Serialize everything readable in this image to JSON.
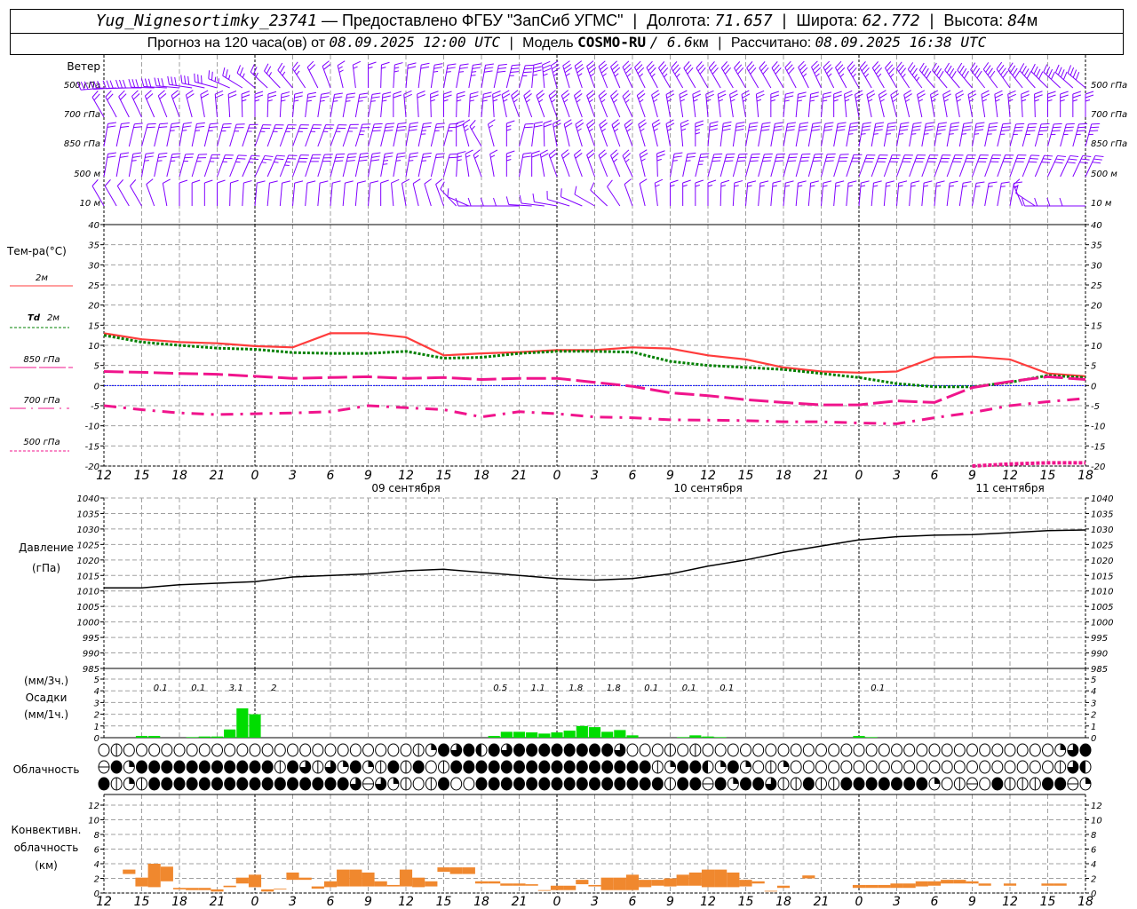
{
  "header": {
    "station": "Yug_Nignesortimky_23741",
    "dash": "—",
    "provider": "Предоставлено ФГБУ \"ЗапСиб УГМС\"",
    "lon_label": "Долгота:",
    "lon_value": "71.657",
    "lat_label": "Широта:",
    "lat_value": "62.772",
    "alt_label": "Высота:",
    "alt_value": "84",
    "alt_unit": "м",
    "forecast_label": "Прогноз на 120 часа(ов) от",
    "forecast_start": "08.09.2025 12:00 UTC",
    "model_label": "Модель",
    "model_name": "COSMO-RU",
    "model_res": "/ 6.6",
    "model_res_unit": "км",
    "calc_label": "Рассчитано:",
    "calc_time": "08.09.2025 16:38 UTC",
    "sep": "|"
  },
  "labels": {
    "wind_title": "Ветер",
    "wind_levels": [
      "500 гПа",
      "700 гПа",
      "850 гПа",
      "500 м",
      "10 м"
    ],
    "temp_title": "Тем-ра(°С)",
    "t2m": "2м",
    "td2m_a": "Td",
    "td2m_b": "2м",
    "t850": "850 гПа",
    "t700": "700 гПа",
    "t500": "500 гПа",
    "pressure_a": "Давление",
    "pressure_b": "(гПа)",
    "precip_a": "(мм/3ч.)",
    "precip_b": "Осадки",
    "precip_c": "(мм/1ч.)",
    "cloud": "Облачность",
    "conv_a": "Конвективн.",
    "conv_b": "облачность",
    "conv_c": "(км)",
    "dates": [
      "09 сентября",
      "10 сентября",
      "11 сентября"
    ]
  },
  "colors": {
    "wind": "#8000ff",
    "t2m": "#ff3c3c",
    "td2m": "#008000",
    "t850": "#f0148c",
    "t700": "#f0148c",
    "t500": "#f0148c",
    "zero_line": "#0000ff",
    "precip": "#00dd00",
    "convective": "#f0882e",
    "grid": "#a0a0a0"
  },
  "chart_data": {
    "type": "line",
    "x_ticks": [
      "12",
      "15",
      "18",
      "21",
      "0",
      "3",
      "6",
      "9",
      "12",
      "15",
      "18",
      "21",
      "0",
      "3",
      "6",
      "9",
      "12",
      "15",
      "18",
      "21",
      "0",
      "3",
      "6",
      "9",
      "12",
      "15",
      "18"
    ],
    "x_lead_h": [
      0,
      3,
      6,
      9,
      12,
      15,
      18,
      21,
      24,
      27,
      30,
      33,
      36,
      39,
      42,
      45,
      48,
      51,
      54,
      57,
      60,
      63,
      66,
      69,
      72,
      75,
      78
    ],
    "wind": {
      "units": "kt",
      "levels": [
        {
          "name": "500 гПа",
          "dir": [
            265,
            270,
            275,
            285,
            310,
            320,
            340,
            0,
            5,
            10,
            10,
            15,
            345,
            340,
            335,
            330,
            330,
            330,
            330,
            335,
            330,
            330,
            320,
            320,
            325,
            315,
            310
          ],
          "speed": [
            30,
            30,
            30,
            30,
            25,
            25,
            20,
            15,
            20,
            25,
            30,
            35,
            35,
            35,
            35,
            35,
            30,
            30,
            30,
            35,
            35,
            35,
            40,
            40,
            40,
            40,
            40
          ]
        },
        {
          "name": "700 гПа",
          "dir": [
            330,
            335,
            340,
            355,
            0,
            5,
            10,
            10,
            355,
            0,
            5,
            340,
            340,
            340,
            335,
            350,
            355,
            350,
            5,
            5,
            350,
            345,
            350,
            350,
            355,
            0,
            0
          ],
          "speed": [
            20,
            20,
            20,
            20,
            25,
            25,
            25,
            25,
            20,
            25,
            25,
            25,
            25,
            25,
            25,
            25,
            25,
            25,
            25,
            25,
            25,
            25,
            25,
            25,
            25,
            25,
            25
          ]
        },
        {
          "name": "850 гПа",
          "dir": [
            10,
            15,
            10,
            15,
            20,
            20,
            20,
            15,
            10,
            15,
            330,
            15,
            350,
            340,
            340,
            350,
            5,
            10,
            10,
            10,
            10,
            10,
            10,
            10,
            15,
            15,
            15
          ],
          "speed": [
            20,
            20,
            25,
            25,
            25,
            25,
            25,
            30,
            30,
            25,
            15,
            20,
            20,
            25,
            25,
            25,
            30,
            30,
            30,
            30,
            35,
            35,
            35,
            35,
            35,
            35,
            35
          ]
        },
        {
          "name": "500 м",
          "dir": [
            10,
            10,
            15,
            20,
            25,
            20,
            15,
            10,
            10,
            15,
            340,
            10,
            340,
            340,
            335,
            10,
            15,
            15,
            15,
            15,
            20,
            20,
            20,
            20,
            20,
            25,
            25
          ],
          "speed": [
            20,
            25,
            25,
            25,
            25,
            30,
            30,
            30,
            25,
            20,
            15,
            20,
            20,
            20,
            25,
            25,
            30,
            30,
            30,
            30,
            30,
            30,
            30,
            30,
            30,
            30,
            30
          ]
        },
        {
          "name": "10 м",
          "dir": [
            330,
            330,
            0,
            0,
            5,
            5,
            5,
            5,
            350,
            340,
            270,
            270,
            280,
            300,
            340,
            0,
            0,
            5,
            5,
            5,
            5,
            5,
            5,
            10,
            10,
            270,
            270
          ],
          "speed": [
            10,
            10,
            10,
            10,
            10,
            10,
            10,
            10,
            10,
            10,
            10,
            10,
            10,
            10,
            10,
            15,
            15,
            15,
            15,
            15,
            15,
            15,
            15,
            15,
            15,
            10,
            10
          ]
        }
      ]
    },
    "temperature": {
      "ylim": [
        -20,
        40
      ],
      "y_ticks": [
        40,
        35,
        30,
        25,
        20,
        15,
        10,
        5,
        0,
        -5,
        -10,
        -15,
        -20
      ],
      "grid": true,
      "series": [
        {
          "name": "2м",
          "values": [
            13,
            11.5,
            10.8,
            10.5,
            9.8,
            9.5,
            13,
            13,
            12,
            7.5,
            8,
            8.3,
            8.8,
            8.8,
            9.5,
            9.2,
            7.5,
            6.5,
            4.5,
            3.5,
            3.2,
            3.5,
            7,
            7.2,
            6.5,
            3,
            2.3
          ]
        },
        {
          "name": "Td 2м",
          "values": [
            12.5,
            10.8,
            10,
            9.3,
            9,
            8.2,
            8,
            8,
            8.5,
            6.8,
            7,
            8,
            8.5,
            8.5,
            8.3,
            6,
            5,
            4.5,
            4,
            3,
            2,
            0.5,
            -0.3,
            -0.3,
            0.8,
            2.5,
            2
          ]
        },
        {
          "name": "850 гПа",
          "values": [
            3.5,
            3.3,
            3,
            2.8,
            2.3,
            1.8,
            2,
            2.2,
            1.8,
            2,
            1.5,
            1.8,
            1.8,
            0.8,
            -0.2,
            -1.8,
            -2.5,
            -3.5,
            -4.2,
            -4.8,
            -4.8,
            -3.8,
            -4.2,
            -0.5,
            1,
            2.2,
            1.5
          ]
        },
        {
          "name": "700 гПа",
          "values": [
            -5,
            -6,
            -6.8,
            -7.2,
            -7,
            -6.8,
            -6.5,
            -5,
            -5.5,
            -6,
            -7.8,
            -6.5,
            -7,
            -7.8,
            -8,
            -8.5,
            -8.6,
            -8.7,
            -9,
            -9,
            -9.3,
            -9.5,
            -8,
            -6.7,
            -5,
            -4,
            -3.2
          ]
        },
        {
          "name": "500 гПа",
          "values": [
            null,
            null,
            null,
            null,
            null,
            null,
            null,
            null,
            null,
            null,
            null,
            null,
            null,
            null,
            null,
            null,
            null,
            null,
            null,
            null,
            null,
            null,
            null,
            -20,
            -19.5,
            -19.2,
            -19.2
          ]
        }
      ]
    },
    "pressure": {
      "ylim": [
        985,
        1040
      ],
      "y_ticks": [
        1040,
        1035,
        1030,
        1025,
        1020,
        1015,
        1010,
        1005,
        1000,
        995,
        990,
        985
      ],
      "values": [
        1011,
        1011,
        1012,
        1012.5,
        1013,
        1014.5,
        1015,
        1015.5,
        1016.5,
        1017,
        1016,
        1015,
        1014,
        1013.5,
        1014,
        1015.5,
        1018,
        1020,
        1022.5,
        1024.5,
        1026.5,
        1027.5,
        1028,
        1028.2,
        1028.8,
        1029.5,
        1029.7
      ]
    },
    "precip": {
      "ylim": [
        0,
        5
      ],
      "y_ticks": [
        0,
        1,
        2,
        3,
        4,
        5
      ],
      "hourly": [
        [
          3,
          0.15
        ],
        [
          4,
          0.15
        ],
        [
          7,
          0.05
        ],
        [
          8,
          0.1
        ],
        [
          9,
          0.1
        ],
        [
          10,
          0.7
        ],
        [
          11,
          2.5
        ],
        [
          12,
          2.0
        ],
        [
          31,
          0.15
        ],
        [
          32,
          0.5
        ],
        [
          33,
          0.5
        ],
        [
          34,
          0.45
        ],
        [
          35,
          0.35
        ],
        [
          36,
          0.45
        ],
        [
          37,
          0.6
        ],
        [
          38,
          1.0
        ],
        [
          39,
          0.9
        ],
        [
          40,
          0.5
        ],
        [
          41,
          0.65
        ],
        [
          42,
          0.2
        ],
        [
          46,
          0.05
        ],
        [
          47,
          0.2
        ],
        [
          48,
          0.1
        ],
        [
          49,
          0.05
        ],
        [
          60,
          0.15
        ],
        [
          61,
          0.05
        ]
      ],
      "totals_3h": [
        {
          "lead_h": 3,
          "text": "0.1"
        },
        {
          "lead_h": 6,
          "text": "0.1"
        },
        {
          "lead_h": 9,
          "text": "3.1"
        },
        {
          "lead_h": 12,
          "text": "2"
        },
        {
          "lead_h": 30,
          "text": "0.5"
        },
        {
          "lead_h": 33,
          "text": "1.1"
        },
        {
          "lead_h": 36,
          "text": "1.8"
        },
        {
          "lead_h": 39,
          "text": "1.8"
        },
        {
          "lead_h": 42,
          "text": "0.1"
        },
        {
          "lead_h": 45,
          "text": "0.1"
        },
        {
          "lead_h": 48,
          "text": "0.1"
        },
        {
          "lead_h": 60,
          "text": "0.1"
        }
      ]
    },
    "cloud_cover_rows": [
      "0v00000000000000000000000vq434243444444443000v0v0000000000000000000000000000q34",
      "h4q44444444444v43v3q4qv4v40v4444444444444444vq442q4q0vq000000000000000000000v32",
      "4vqv44444444444444443h3qv0v400444444444444444v44h4q443vv4vv4444444q0vh04vvv44hq"
    ],
    "convective": {
      "ylim": [
        0,
        14
      ],
      "y_ticks": [
        0,
        2,
        4,
        6,
        8,
        10,
        12
      ],
      "bars": [
        [
          2,
          2.6,
          3.2
        ],
        [
          3,
          0.9,
          2.1
        ],
        [
          4,
          0.8,
          4.0
        ],
        [
          5,
          1.6,
          3.6
        ],
        [
          6,
          0.5,
          0.7
        ],
        [
          7,
          0.4,
          0.7
        ],
        [
          8,
          0.4,
          0.7
        ],
        [
          9,
          0.2,
          0.5
        ],
        [
          10,
          0.8,
          1.0
        ],
        [
          11,
          1.3,
          2.1
        ],
        [
          12,
          0.8,
          2.5
        ],
        [
          13,
          0.2,
          0.5
        ],
        [
          14,
          0.5,
          0.6
        ],
        [
          15,
          1.8,
          2.8
        ],
        [
          16,
          1.8,
          2.1
        ],
        [
          17,
          0.6,
          0.9
        ],
        [
          18,
          0.8,
          1.6
        ],
        [
          19,
          0.9,
          3.2
        ],
        [
          20,
          0.9,
          3.2
        ],
        [
          21,
          0.9,
          2.8
        ],
        [
          22,
          0.9,
          1.6
        ],
        [
          23,
          0.9,
          1.1
        ],
        [
          24,
          0.9,
          3.2
        ],
        [
          25,
          0.8,
          2.1
        ],
        [
          26,
          0.9,
          1.6
        ],
        [
          27,
          2.9,
          3.5
        ],
        [
          28,
          2.6,
          3.5
        ],
        [
          29,
          2.6,
          3.5
        ],
        [
          30,
          1.3,
          1.6
        ],
        [
          31,
          1.3,
          1.6
        ],
        [
          32,
          1.0,
          1.3
        ],
        [
          33,
          1.0,
          1.3
        ],
        [
          34,
          1.0,
          1.2
        ],
        [
          35,
          0.3,
          0.4
        ],
        [
          36,
          0.4,
          1.0
        ],
        [
          37,
          0.4,
          1.0
        ],
        [
          38,
          1.2,
          1.8
        ],
        [
          39,
          0.9,
          1.1
        ],
        [
          40,
          0.4,
          2.1
        ],
        [
          41,
          0.4,
          2.1
        ],
        [
          42,
          0.4,
          2.5
        ],
        [
          43,
          0.8,
          1.8
        ],
        [
          44,
          1.0,
          1.8
        ],
        [
          45,
          0.9,
          2.0
        ],
        [
          46,
          1.0,
          2.5
        ],
        [
          47,
          1.0,
          2.8
        ],
        [
          48,
          0.8,
          3.2
        ],
        [
          49,
          0.8,
          3.2
        ],
        [
          50,
          0.8,
          2.8
        ],
        [
          51,
          0.9,
          1.8
        ],
        [
          52,
          1.3,
          1.6
        ],
        [
          53,
          0.2,
          0.3
        ],
        [
          54,
          0.7,
          1.0
        ],
        [
          56,
          2.0,
          2.4
        ],
        [
          60,
          0.7,
          1.1
        ],
        [
          61,
          0.7,
          1.1
        ],
        [
          62,
          0.7,
          1.1
        ],
        [
          63,
          0.7,
          1.3
        ],
        [
          64,
          0.7,
          1.3
        ],
        [
          65,
          0.9,
          1.6
        ],
        [
          66,
          1.0,
          1.6
        ],
        [
          67,
          1.3,
          1.8
        ],
        [
          68,
          1.3,
          1.8
        ],
        [
          69,
          1.3,
          1.6
        ],
        [
          70,
          1.0,
          1.3
        ],
        [
          72,
          1.0,
          1.3
        ],
        [
          75,
          1.0,
          1.3
        ],
        [
          76,
          1.0,
          1.3
        ]
      ]
    }
  }
}
